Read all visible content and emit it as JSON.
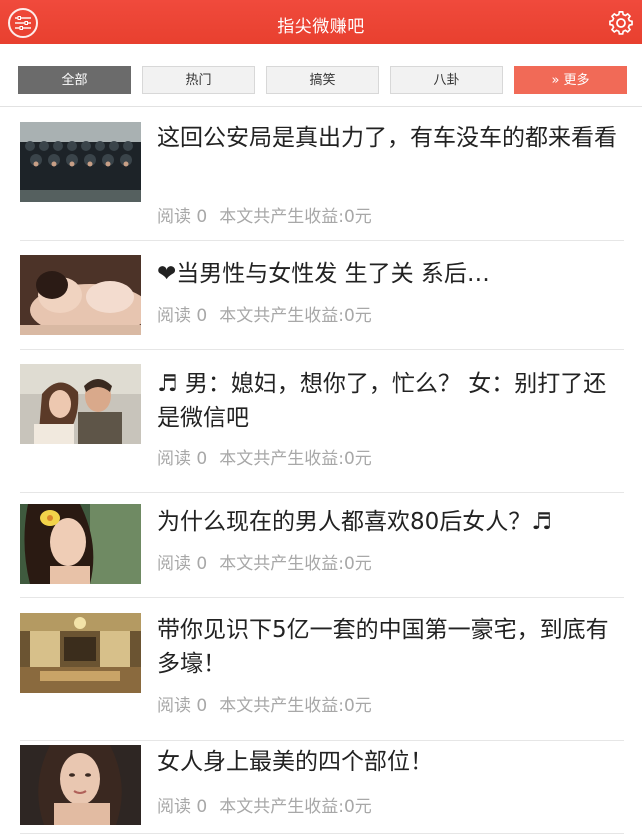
{
  "header": {
    "title": "指尖微赚吧",
    "bg_color": "#e8402f",
    "left_icon": "sliders-icon",
    "right_icon": "gear-icon"
  },
  "tabs": [
    {
      "label": "全部",
      "active": true
    },
    {
      "label": "热门",
      "active": false
    },
    {
      "label": "搞笑",
      "active": false
    },
    {
      "label": "八卦",
      "active": false
    },
    {
      "label": "» 更多",
      "active": false
    }
  ],
  "articles": [
    {
      "title": "这回公安局是真出力了，有车没车的都来看看",
      "read_label": "阅读 0",
      "earnings_label": "本文共产生收益:0元"
    },
    {
      "title": "❤当男性与女性发 生了关 系后…",
      "read_label": "阅读 0",
      "earnings_label": "本文共产生收益:0元"
    },
    {
      "title": "♬ 男：媳妇，想你了，忙么？ 女：别打了还是微信吧",
      "read_label": "阅读 0",
      "earnings_label": "本文共产生收益:0元"
    },
    {
      "title": "为什么现在的男人都喜欢80后女人？♬",
      "read_label": "阅读 0",
      "earnings_label": "本文共产生收益:0元"
    },
    {
      "title": "带你见识下5亿一套的中国第一豪宅，到底有多壕！",
      "read_label": "阅读 0",
      "earnings_label": "本文共产生收益:0元"
    },
    {
      "title": "女人身上最美的四个部位！",
      "read_label": "阅读 0",
      "earnings_label": "本文共产生收益:0元"
    }
  ]
}
